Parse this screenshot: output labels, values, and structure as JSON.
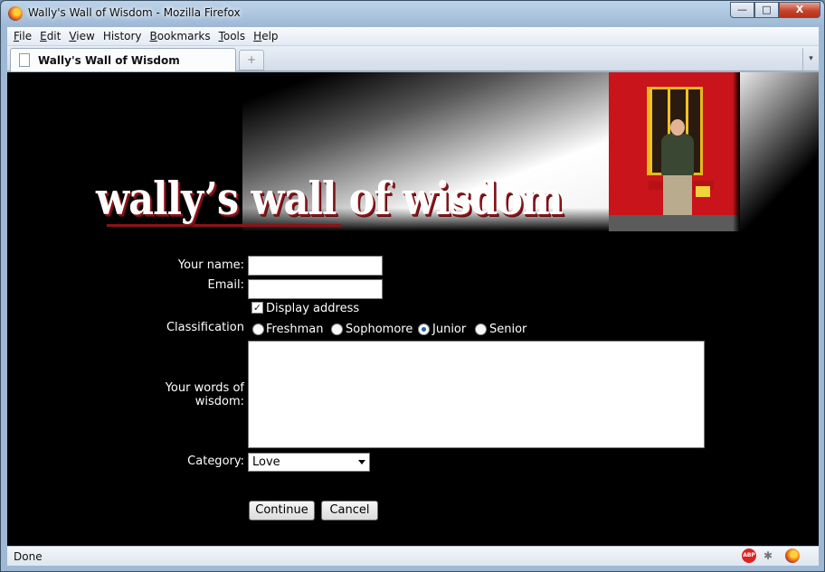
{
  "window": {
    "title": "Wally's Wall of Wisdom - Mozilla Firefox",
    "buttons": {
      "minimize": "—",
      "maximize": "□",
      "close": "X"
    }
  },
  "menubar": {
    "items": [
      {
        "label": "File",
        "accel": "F",
        "rest": "ile"
      },
      {
        "label": "Edit",
        "accel": "E",
        "rest": "dit"
      },
      {
        "label": "View",
        "accel": "V",
        "rest": "iew"
      },
      {
        "label": "History",
        "accel": "",
        "rest": "History"
      },
      {
        "label": "Bookmarks",
        "accel": "B",
        "rest": "ookmarks"
      },
      {
        "label": "Tools",
        "accel": "T",
        "rest": "ools"
      },
      {
        "label": "Help",
        "accel": "H",
        "rest": "elp"
      }
    ]
  },
  "tabs": {
    "active_label": "Wally's Wall of Wisdom",
    "new_tab_symbol": "+",
    "list_symbol": "▾"
  },
  "banner": {
    "site_title": "wally’s wall of wisdom"
  },
  "form": {
    "name_label": "Your name:",
    "name_value": "",
    "email_label": "Email:",
    "email_value": "",
    "display_address_label": "Display address",
    "display_address_checked": true,
    "classification_label": "Classification",
    "classification_options": [
      "Freshman",
      "Sophomore",
      "Junior",
      "Senior"
    ],
    "classification_selected": "Junior",
    "wisdom_label_line1": "Your words of",
    "wisdom_label_line2": "wisdom:",
    "wisdom_value": "",
    "category_label": "Category:",
    "category_selected": "Love",
    "continue_label": "Continue",
    "cancel_label": "Cancel"
  },
  "statusbar": {
    "text": "Done",
    "abp_icon_text": "ABP",
    "icons": [
      "adblock-icon",
      "firebug-icon",
      "firefox-icon"
    ]
  },
  "colors": {
    "page_background": "#000000",
    "title_shadow": "#8b1418",
    "radio_selected": "#1f5fb5"
  }
}
